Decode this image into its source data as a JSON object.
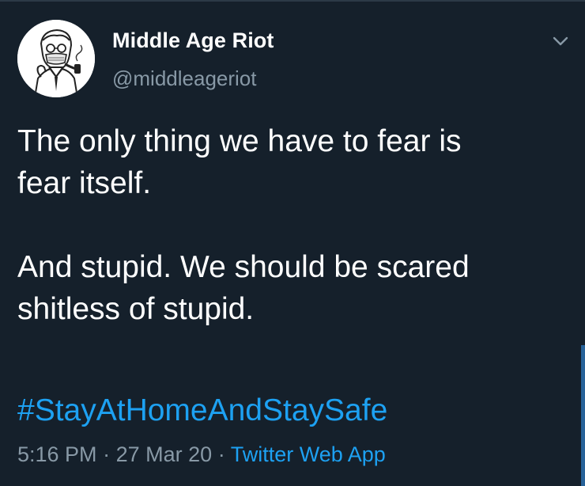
{
  "author": {
    "display_name": "Middle Age Riot",
    "handle": "@middleageriot",
    "avatar_icon": "masked-man-with-pipe-illustration"
  },
  "menu": {
    "icon": "chevron-down-icon"
  },
  "tweet": {
    "paragraph_1": {
      "line_1": "The only thing we have to fear is",
      "line_2": "fear itself."
    },
    "paragraph_2": {
      "line_1": "And stupid. We should be scared",
      "line_2": "shitless of stupid."
    },
    "hashtag": "#StayAtHomeAndStaySafe"
  },
  "meta": {
    "time": "5:16 PM",
    "separator": "·",
    "date": "27 Mar 20",
    "source": "Twitter Web App"
  },
  "colors": {
    "background": "#15202b",
    "text": "#ffffff",
    "secondary": "#8899a6",
    "link": "#1da1f2"
  }
}
